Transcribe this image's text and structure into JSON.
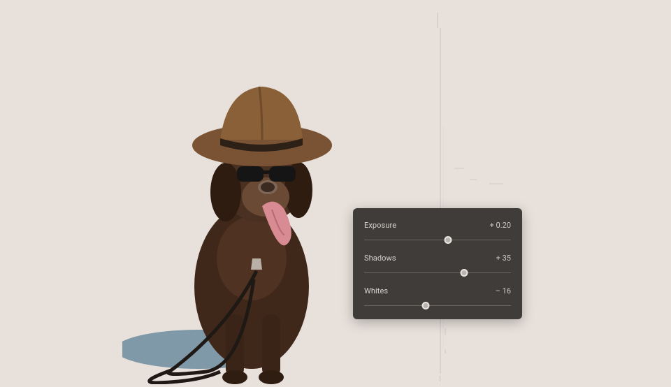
{
  "panel": {
    "sliders": [
      {
        "label": "Exposure",
        "value": "+ 0.20",
        "thumb_percent": 57
      },
      {
        "label": "Shadows",
        "value": "+ 35",
        "thumb_percent": 68
      },
      {
        "label": "Whites",
        "value": "– 16",
        "thumb_percent": 42
      }
    ]
  }
}
